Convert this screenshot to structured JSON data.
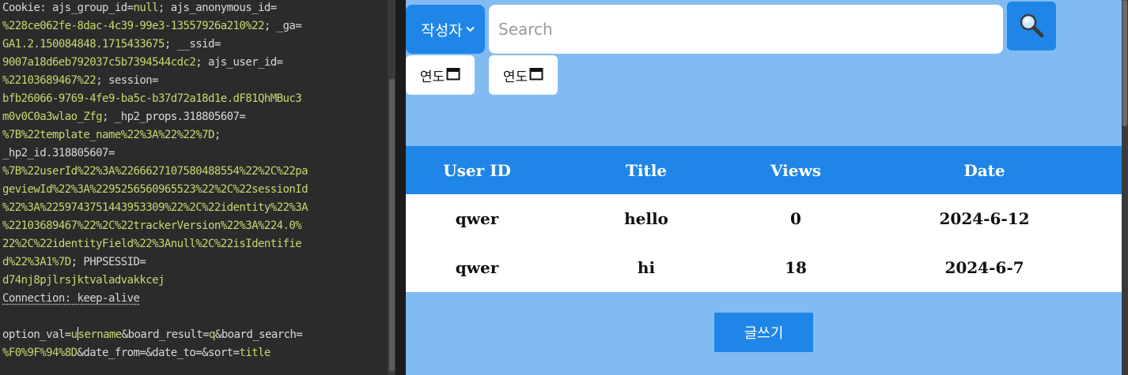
{
  "request": {
    "lines": [
      [
        {
          "t": "Cookie: ajs_group_id=",
          "c": "k"
        },
        {
          "t": "null",
          "c": "v"
        },
        {
          "t": "; ajs_anonymous_id=",
          "c": "k"
        }
      ],
      [
        {
          "t": "%228ce062fe-8dac-4c39-99e3-13557926a210%22",
          "c": "v"
        },
        {
          "t": "; _ga=",
          "c": "k"
        }
      ],
      [
        {
          "t": "GA1.2.150084848.1715433675",
          "c": "v"
        },
        {
          "t": "; __ssid=",
          "c": "k"
        }
      ],
      [
        {
          "t": "9007a18d6eb792037c5b7394544cdc2",
          "c": "v"
        },
        {
          "t": "; ajs_user_id=",
          "c": "k"
        }
      ],
      [
        {
          "t": "%22103689467%22",
          "c": "v"
        },
        {
          "t": "; session=",
          "c": "k"
        }
      ],
      [
        {
          "t": "bfb26066-9769-4fe9-ba5c-b37d72a18d1e.dF81QhMBuc3",
          "c": "v"
        }
      ],
      [
        {
          "t": "m0v0C0a3wlao_Zfg",
          "c": "v"
        },
        {
          "t": "; _hp2_props.318805607=",
          "c": "k"
        }
      ],
      [
        {
          "t": "%7B%22template_name%22%3A%22%22%7D",
          "c": "v"
        },
        {
          "t": ";",
          "c": "k"
        }
      ],
      [
        {
          "t": "_hp2_id.318805607=",
          "c": "k"
        }
      ],
      [
        {
          "t": "%7B%22userId%22%3A%2266627107580488554%22%2C%22pa",
          "c": "v"
        }
      ],
      [
        {
          "t": "geviewId%22%3A%2295256560965523%22%2C%22sessionId",
          "c": "v"
        }
      ],
      [
        {
          "t": "%22%3A%2259743751443953309%22%2C%22identity%22%3A",
          "c": "v"
        }
      ],
      [
        {
          "t": "%22103689467%22%2C%22trackerVersion%22%3A%224.0%",
          "c": "v"
        }
      ],
      [
        {
          "t": "22%2C%22identityField%22%3Anull%2C%22isIdentifie",
          "c": "v"
        }
      ],
      [
        {
          "t": "d%22%3A1%7D",
          "c": "v"
        },
        {
          "t": "; PHPSESSID=",
          "c": "k"
        }
      ],
      [
        {
          "t": "d74nj8pjlrsjktvaladvakkcej",
          "c": "v"
        }
      ],
      [
        {
          "t": "Connection: keep-alive",
          "c": "k u"
        }
      ],
      [],
      [
        {
          "t": "option_val=",
          "c": "k"
        },
        {
          "t": "u",
          "c": "v"
        },
        {
          "t": "CARET",
          "c": "caret"
        },
        {
          "t": "sername",
          "c": "v"
        },
        {
          "t": "&board_result=",
          "c": "k"
        },
        {
          "t": "q",
          "c": "v"
        },
        {
          "t": "&board_search=",
          "c": "k"
        }
      ],
      [
        {
          "t": "%F0%9F%94%8D",
          "c": "v"
        },
        {
          "t": "&date_from=&date_to=&sort=",
          "c": "k"
        },
        {
          "t": "title",
          "c": "v"
        }
      ]
    ]
  },
  "search": {
    "select_label": "작성자",
    "placeholder": "Search",
    "button_icon": "magnifier-icon"
  },
  "dates": {
    "from_label": "연도",
    "to_label": "연도",
    "icon": "calendar-icon"
  },
  "table": {
    "headers": [
      "User ID",
      "Title",
      "Views",
      "Date"
    ],
    "rows": [
      [
        "qwer",
        "hello",
        "0",
        "2024-6-12"
      ],
      [
        "qwer",
        "hi",
        "18",
        "2024-6-7"
      ]
    ]
  },
  "write_button": "글쓰기",
  "colors": {
    "page_bg": "#82bbf2",
    "accent": "#1f86e8",
    "editor_bg": "#2b2b2b",
    "value_text": "#c9d86e"
  }
}
